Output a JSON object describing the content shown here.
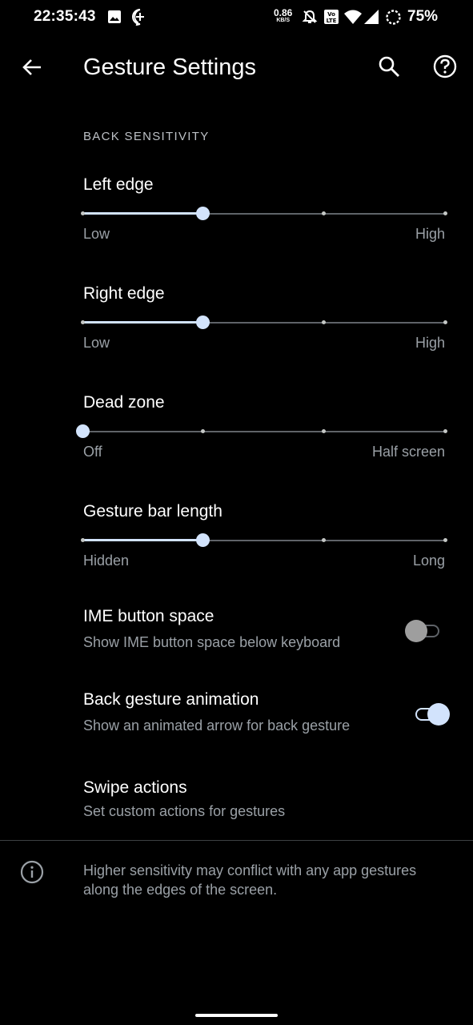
{
  "status_bar": {
    "time": "22:35:43",
    "net_speed_value": "0.86",
    "net_speed_unit": "KB/S",
    "battery": "75%",
    "icons": [
      "image-icon",
      "messenger-icon",
      "bell-off-icon",
      "volte-icon",
      "wifi-icon",
      "signal-icon",
      "battery-saver-icon"
    ]
  },
  "app_bar": {
    "title": "Gesture Settings"
  },
  "section": {
    "header": "BACK SENSITIVITY"
  },
  "sliders": [
    {
      "title": "Left edge",
      "min_label": "Low",
      "max_label": "High",
      "steps": 4,
      "value_step": 1
    },
    {
      "title": "Right edge",
      "min_label": "Low",
      "max_label": "High",
      "steps": 4,
      "value_step": 1
    },
    {
      "title": "Dead zone",
      "min_label": "Off",
      "max_label": "Half screen",
      "steps": 4,
      "value_step": 0
    },
    {
      "title": "Gesture bar length",
      "min_label": "Hidden",
      "max_label": "Long",
      "steps": 4,
      "value_step": 1
    }
  ],
  "switches": [
    {
      "title": "IME button space",
      "summary": "Show IME button space below keyboard",
      "checked": false
    },
    {
      "title": "Back gesture animation",
      "summary": "Show an animated arrow for back gesture",
      "checked": true
    }
  ],
  "swipe_actions": {
    "title": "Swipe actions",
    "summary": "Set custom actions for gestures"
  },
  "footer": {
    "text": "Higher sensitivity may conflict with any app gestures along the edges of the screen."
  },
  "colors": {
    "accent": "#d2e3fc",
    "background": "#000000",
    "secondary_text": "#9aa0a6"
  }
}
